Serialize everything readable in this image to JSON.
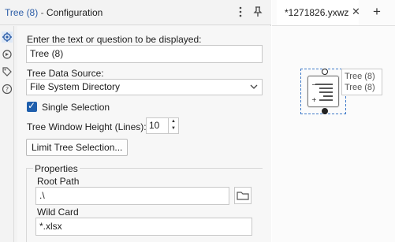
{
  "header": {
    "tool_name": "Tree (8)",
    "separator": "-",
    "panel_name": "Configuration",
    "more_icon": "more-vertical-icon",
    "pin_icon": "pin-icon"
  },
  "rail": {
    "items": [
      {
        "icon": "gear-icon",
        "active": true
      },
      {
        "icon": "workflow-icon",
        "active": false
      },
      {
        "icon": "tag-icon",
        "active": false
      },
      {
        "icon": "help-icon",
        "active": false
      }
    ]
  },
  "form": {
    "prompt_label": "Enter the text or question to be displayed:",
    "prompt_value": "Tree (8)",
    "source_label": "Tree Data Source:",
    "source_value": "File System Directory",
    "single_selection_label": "Single Selection",
    "single_selection_checked": true,
    "height_label": "Tree Window Height (Lines):",
    "height_value": "10",
    "limit_button": "Limit Tree Selection...",
    "properties_title": "Properties",
    "root_path_label": "Root Path",
    "root_path_value": ".\\",
    "wild_card_label": "Wild Card",
    "wild_card_value": "*.xlsx"
  },
  "canvas": {
    "tab_label": "*1271826.yxwz",
    "tab_close_icon": "close-icon",
    "add_tab_icon": "plus-icon",
    "node_annotation_line1": "Tree (8)",
    "node_annotation_line2": "Tree (8)",
    "selection_color": "#3c78c8"
  },
  "colors": {
    "accent": "#1f5fad",
    "panel_bg": "#f3f3f3",
    "title_tool": "#2d5ea8"
  }
}
